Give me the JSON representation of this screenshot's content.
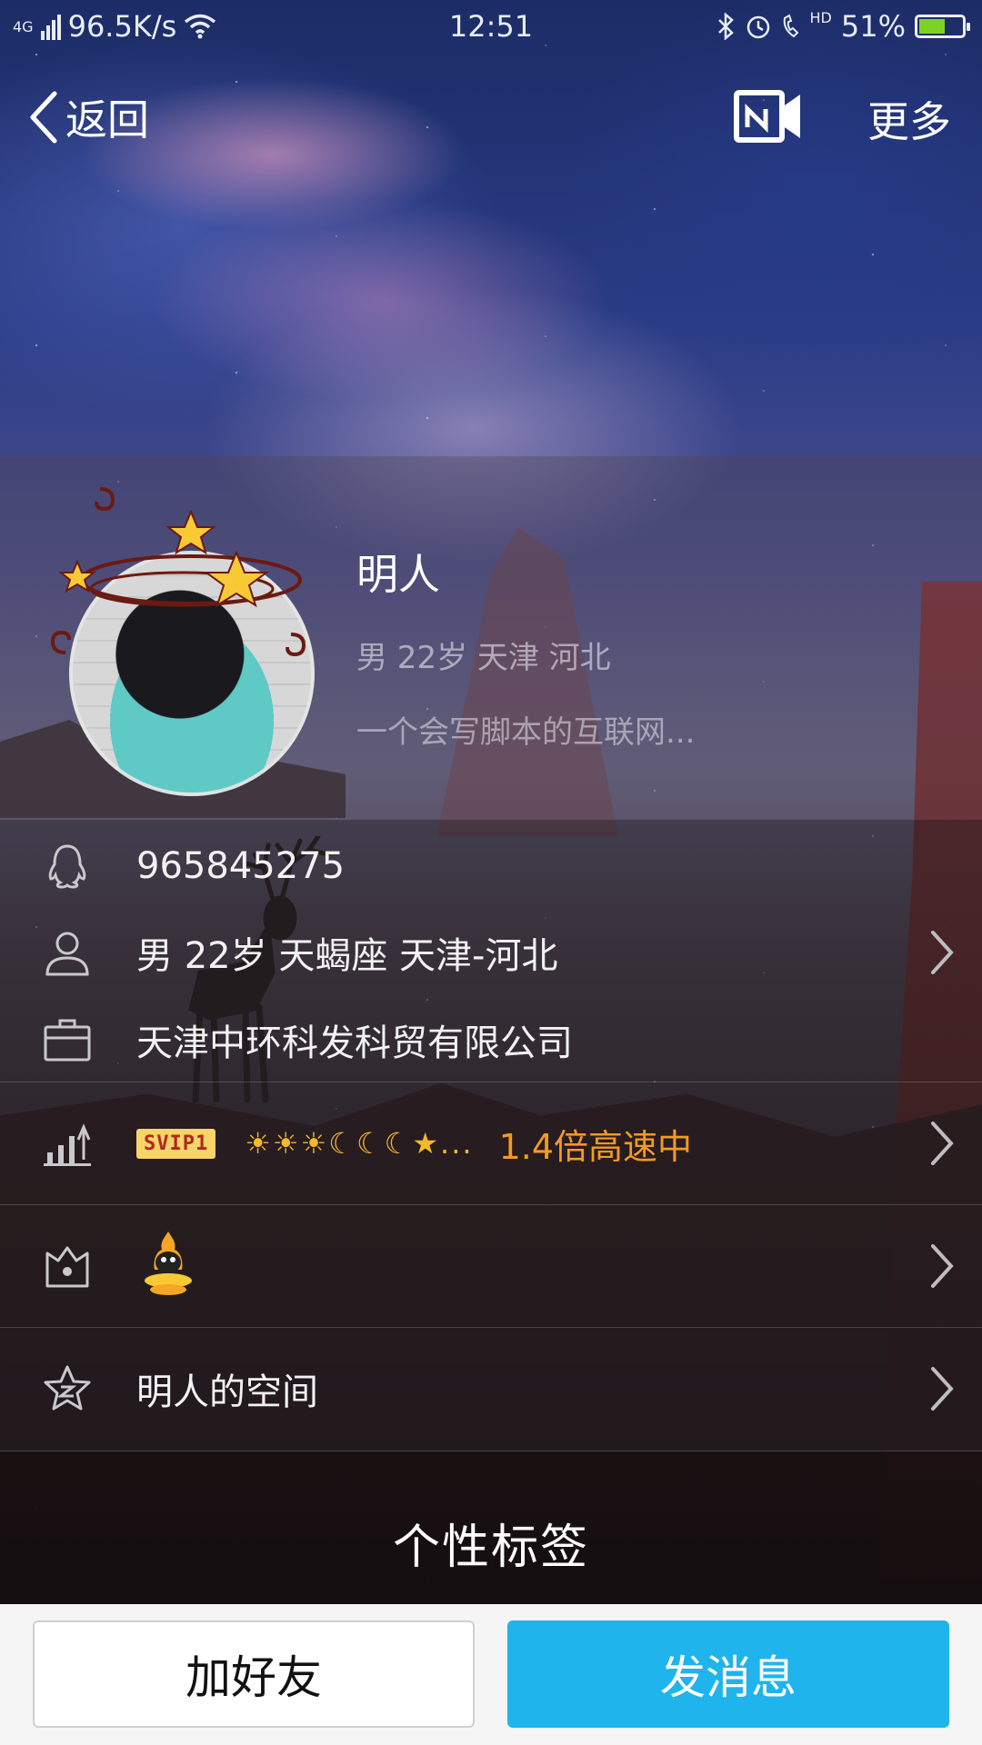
{
  "status_bar": {
    "network": "4G",
    "speed": "96.5K/s",
    "time": "12:51",
    "hd": "HD",
    "battery": "51%",
    "battery_color": "#7ed321"
  },
  "nav": {
    "back_label": "返回",
    "more_label": "更多",
    "share_icon": "screen-share-icon"
  },
  "profile": {
    "nickname": "明人",
    "meta": "男 22岁 天津 河北",
    "signature": "一个会写脚本的互联网..."
  },
  "info": {
    "qq_number": "965845275",
    "personal": "男  22岁  天蝎座  天津-河北",
    "company": "天津中环科发科贸有限公司",
    "svip_badge": "SVIP1",
    "level_icons": "☀☀☀☾☾☾★...",
    "speed": "1.4倍高速中",
    "space": "明人的空间"
  },
  "tags_title": "个性标签",
  "actions": {
    "add_friend": "加好友",
    "send_message": "发消息",
    "accent_color": "#1fb5ec"
  }
}
